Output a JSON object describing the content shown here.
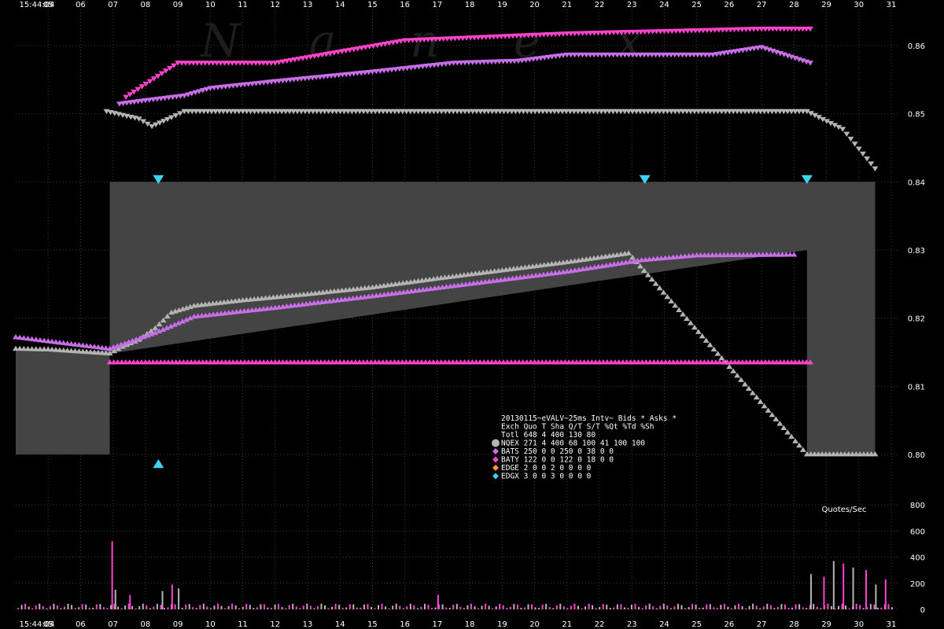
{
  "chart_data": {
    "type": "scatter",
    "watermark": [
      "N",
      "a",
      "n",
      "e",
      "x"
    ],
    "time_label": "15:44:04",
    "x_ticks": [
      "05",
      "06",
      "07",
      "08",
      "09",
      "10",
      "11",
      "12",
      "13",
      "14",
      "15",
      "16",
      "17",
      "18",
      "19",
      "20",
      "21",
      "22",
      "23",
      "24",
      "25",
      "26",
      "27",
      "28",
      "29",
      "30",
      "31"
    ],
    "x_range": [
      4,
      31
    ],
    "price_axis": {
      "ticks": [
        "0.86",
        "0.85",
        "0.84",
        "0.83",
        "0.82",
        "0.81",
        "0.80"
      ],
      "range": [
        0.8,
        0.86
      ]
    },
    "volume_axis": {
      "ticks": [
        "800",
        "600",
        "400",
        "200",
        "0"
      ],
      "range": [
        0,
        800
      ],
      "label": "Quotes/Sec"
    },
    "nbbo_spread": [
      {
        "x": 4.0,
        "bid": 0.8,
        "ask": 0.8152
      },
      {
        "x": 6.9,
        "bid": 0.8,
        "ask": 0.8152
      },
      {
        "x": 6.9,
        "bid": 0.8148,
        "ask": 0.84
      },
      {
        "x": 28.4,
        "bid": 0.83,
        "ask": 0.84
      },
      {
        "x": 28.4,
        "bid": 0.8,
        "ask": 0.84
      },
      {
        "x": 30.5,
        "bid": 0.8,
        "ask": 0.84
      }
    ],
    "series": [
      {
        "name": "NQEX",
        "color": "#b4b4b4",
        "bids": [
          [
            4.0,
            0.8155
          ],
          [
            5.0,
            0.8154
          ],
          [
            6.9,
            0.8148
          ],
          [
            7.3,
            0.8158
          ],
          [
            7.8,
            0.8168
          ],
          [
            8.3,
            0.8185
          ],
          [
            8.8,
            0.8208
          ],
          [
            9.5,
            0.8218
          ],
          [
            11,
            0.8226
          ],
          [
            13,
            0.8235
          ],
          [
            15,
            0.8245
          ],
          [
            17,
            0.8258
          ],
          [
            19,
            0.827
          ],
          [
            21,
            0.8282
          ],
          [
            22.9,
            0.8295
          ],
          [
            28.4,
            0.8
          ],
          [
            30.5,
            0.8
          ]
        ],
        "asks": [
          [
            6.8,
            0.8504
          ],
          [
            7.8,
            0.8493
          ],
          [
            8.2,
            0.8482
          ],
          [
            8.8,
            0.8495
          ],
          [
            9.2,
            0.8504
          ],
          [
            22.9,
            0.8504
          ],
          [
            28.4,
            0.8504
          ],
          [
            29.5,
            0.8478
          ],
          [
            30.5,
            0.842
          ]
        ]
      },
      {
        "name": "BATS",
        "color": "#c86ee8",
        "bids": [
          [
            4.0,
            0.8172
          ],
          [
            5.0,
            0.8166
          ],
          [
            6.9,
            0.8155
          ],
          [
            8.3,
            0.8178
          ],
          [
            9.5,
            0.8202
          ],
          [
            12,
            0.8215
          ],
          [
            15,
            0.8232
          ],
          [
            18,
            0.825
          ],
          [
            21,
            0.8268
          ],
          [
            23.3,
            0.8285
          ],
          [
            25,
            0.8292
          ],
          [
            28,
            0.8293
          ]
        ],
        "asks": [
          [
            7.2,
            0.8515
          ],
          [
            8.0,
            0.852
          ],
          [
            9.2,
            0.8527
          ],
          [
            10,
            0.8538
          ],
          [
            12,
            0.8548
          ],
          [
            13.5,
            0.8555
          ],
          [
            15,
            0.8562
          ],
          [
            17.5,
            0.8575
          ],
          [
            19.5,
            0.8578
          ],
          [
            21,
            0.8587
          ],
          [
            23.5,
            0.8587
          ],
          [
            25.5,
            0.8587
          ],
          [
            27,
            0.8598
          ],
          [
            28.5,
            0.8575
          ]
        ]
      },
      {
        "name": "BATY",
        "color": "#ff44cc",
        "bids": [
          [
            6.9,
            0.8135
          ],
          [
            8.0,
            0.8135
          ],
          [
            10,
            0.8135
          ],
          [
            12,
            0.8135
          ],
          [
            14,
            0.8135
          ],
          [
            17,
            0.8135
          ],
          [
            20,
            0.8135
          ],
          [
            22,
            0.8135
          ],
          [
            25,
            0.8135
          ],
          [
            27,
            0.8135
          ],
          [
            28.5,
            0.8135
          ]
        ],
        "asks": [
          [
            7.4,
            0.8525
          ],
          [
            9.0,
            0.8575
          ],
          [
            12,
            0.8575
          ],
          [
            16,
            0.8608
          ],
          [
            21,
            0.8618
          ],
          [
            27,
            0.8625
          ],
          [
            28.5,
            0.8625
          ]
        ]
      },
      {
        "name": "EDGE",
        "color": "#ff9933",
        "bids": [],
        "asks": []
      },
      {
        "name": "EDGX",
        "color": "#40d0f0",
        "bids": [
          [
            8.4,
            0.7985
          ]
        ],
        "asks": [
          [
            8.4,
            0.8405
          ],
          [
            23.4,
            0.8405
          ],
          [
            28.4,
            0.8405
          ]
        ]
      }
    ],
    "legend": {
      "title": "20130115~eVALV~25ms Intv~ Bids * Asks *",
      "header": "Exch Quo T Sha  Q/T   S/T  %Qt %Td %Sh",
      "rows": [
        {
          "color": "#b4b4b4",
          "shape": "circle",
          "text": "Totl 648 4 400   130    80"
        },
        {
          "color": "#b4b4b4",
          "shape": "circle",
          "text": "NQEX 271 4 400    68   100   41 100 100"
        },
        {
          "color": "#c86ee8",
          "shape": "diamond",
          "text": "BATS 250 0   0   250     0   38   0   0"
        },
        {
          "color": "#ff44cc",
          "shape": "diamond",
          "text": "BATY 122 0   0   122     0   18   0   0"
        },
        {
          "color": "#ff9933",
          "shape": "diamond",
          "text": "EDGE   2 0   0     2     0    0   0   0"
        },
        {
          "color": "#40d0f0",
          "shape": "diamond",
          "text": "EDGX   3 0   0     3     0    0   0   0"
        }
      ]
    },
    "volume_bars": {
      "series_colors": [
        "#ff44cc",
        "#b4b4b4"
      ],
      "peaks": [
        {
          "x": 6.95,
          "value": 520
        },
        {
          "x": 7.05,
          "value": 150
        },
        {
          "x": 7.5,
          "value": 110
        },
        {
          "x": 8.5,
          "value": 140
        },
        {
          "x": 8.8,
          "value": 190
        },
        {
          "x": 9.0,
          "value": 160
        },
        {
          "x": 17.0,
          "value": 110
        },
        {
          "x": 28.5,
          "value": 270
        },
        {
          "x": 28.9,
          "value": 250
        },
        {
          "x": 29.2,
          "value": 370
        },
        {
          "x": 29.5,
          "value": 350
        },
        {
          "x": 29.8,
          "value": 320
        },
        {
          "x": 30.2,
          "value": 300
        },
        {
          "x": 30.5,
          "value": 190
        },
        {
          "x": 30.8,
          "value": 230
        }
      ]
    },
    "grid": true
  }
}
